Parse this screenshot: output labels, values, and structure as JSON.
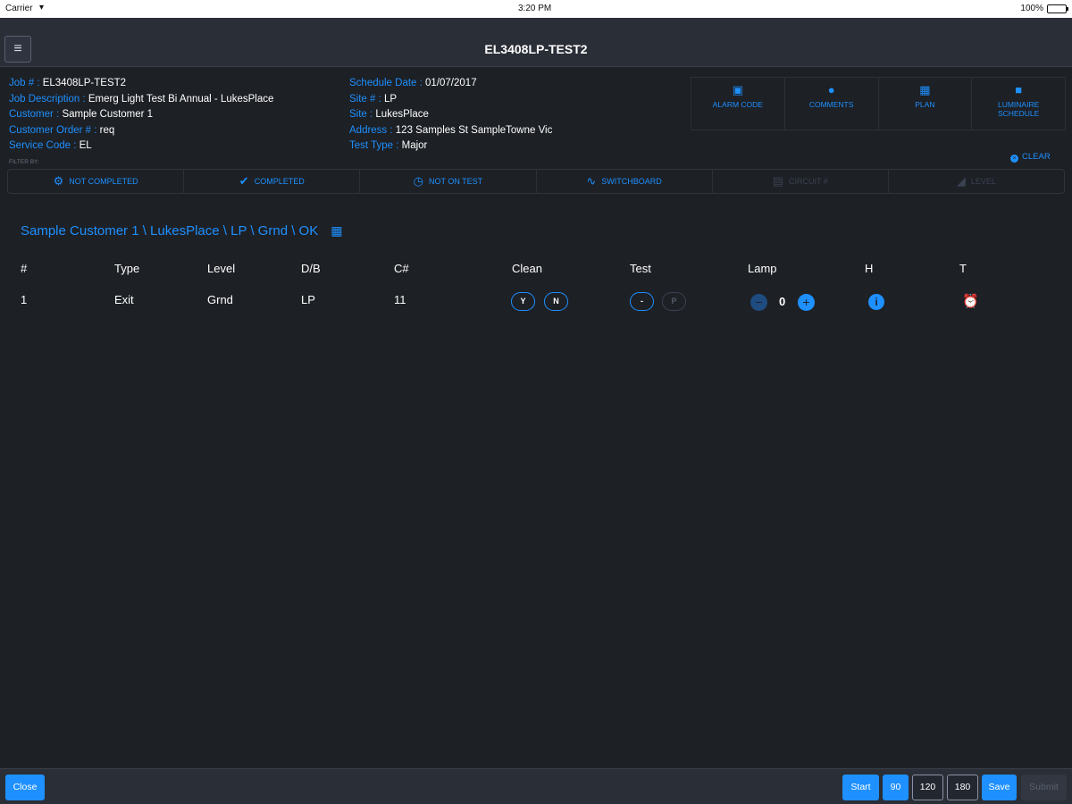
{
  "status_bar": {
    "carrier": "Carrier",
    "wifi_icon": "wifi-icon",
    "time": "3:20 PM",
    "battery": "100%"
  },
  "nav": {
    "menu_icon": "≡",
    "title": "EL3408LP-TEST2"
  },
  "job": {
    "job_label": "Job # : ",
    "job_value": "EL3408LP-TEST2",
    "desc_label": "Job Description : ",
    "desc_value": "Emerg Light Test Bi Annual - LukesPlace",
    "customer_label": "Customer : ",
    "customer_value": "Sample Customer 1",
    "order_label": "Customer Order # : ",
    "order_value": "req",
    "service_label": "Service Code : ",
    "service_value": "EL",
    "schedule_label": "Schedule Date : ",
    "schedule_value": "01/07/2017",
    "site_no_label": "Site # : ",
    "site_no_value": "LP",
    "site_label": "Site : ",
    "site_value": "LukesPlace",
    "address_label": "Address : ",
    "address_value": "123 Samples St SampleTowne Vic",
    "test_type_label": "Test Type : ",
    "test_type_value": "Major"
  },
  "actions": {
    "alarm_code": "ALARM CODE",
    "comments": "COMMENTS",
    "plan": "PLAN",
    "luminaire_line1": "LUMINAIRE",
    "luminaire_line2": "SCHEDULE"
  },
  "filter": {
    "filter_by": "FILTER BY:",
    "clear": "CLEAR",
    "not_completed": "NOT COMPLETED",
    "completed": "COMPLETED",
    "not_on_test": "NOT ON TEST",
    "switchboard": "SWITCHBOARD",
    "circuit": "CIRCUIT #",
    "level": "LEVEL"
  },
  "breadcrumb": {
    "path": "Sample Customer 1 \\ LukesPlace \\ LP \\ Grnd \\ OK",
    "icon": "map-icon"
  },
  "table": {
    "headers": {
      "num": "#",
      "type": "Type",
      "level": "Level",
      "db": "D/B",
      "cnum": "C#",
      "clean": "Clean",
      "test": "Test",
      "lamp": "Lamp",
      "h": "H",
      "t": "T"
    },
    "row": {
      "num": "1",
      "type": "Exit",
      "level": "Grnd",
      "db": "LP",
      "cnum": "11",
      "clean_yes": "Y",
      "clean_no": "N",
      "test_minus": "-",
      "test_pass": "P",
      "lamp_minus": "−",
      "lamp_count": "0",
      "lamp_plus": "+",
      "info": "i"
    }
  },
  "toolbar": {
    "close": "Close",
    "start": "Start",
    "t90": "90",
    "t120": "120",
    "t180": "180",
    "save": "Save",
    "submit": "Submit"
  },
  "colors": {
    "accent": "#1e90ff",
    "background": "#1d2025",
    "bar": "#2a2e37"
  }
}
